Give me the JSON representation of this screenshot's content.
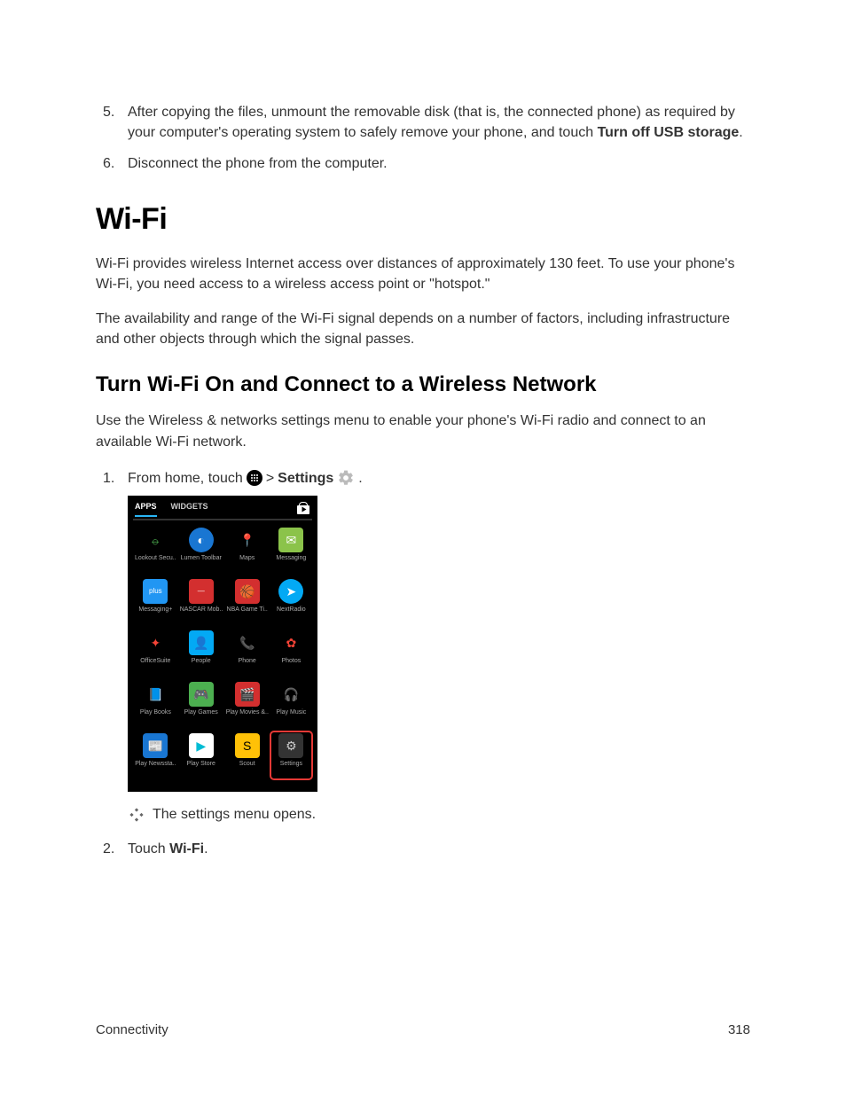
{
  "list_a": {
    "i5": {
      "num": "5.",
      "pre": "After copying the files, unmount the removable disk (that is, the connected phone) as required by your computer's operating system to safely remove your phone, and touch ",
      "bold": "Turn off USB storage",
      "post": "."
    },
    "i6": {
      "num": "6.",
      "text": "Disconnect the phone from the computer."
    }
  },
  "heading_wifi": "Wi-Fi",
  "para_wifi_1": "Wi-Fi provides wireless Internet access over distances of approximately 130 feet. To use your phone's Wi-Fi, you need access to a wireless access point or \"hotspot.\"",
  "para_wifi_2": "The availability and range of the Wi-Fi signal depends on a number of factors, including infrastructure and other objects through which the signal passes.",
  "heading_turn": "Turn Wi-Fi On and Connect to a Wireless Network",
  "para_turn": "Use the Wireless & networks settings menu to enable your phone's Wi-Fi radio and connect to an available Wi-Fi network.",
  "steps": {
    "s1": {
      "num": "1.",
      "pre": "From home, touch ",
      "gt": " > ",
      "settings_bold": "Settings",
      "period": " ."
    },
    "s2": {
      "num": "2.",
      "pre": "Touch ",
      "bold": "Wi-Fi",
      "post": "."
    }
  },
  "phone": {
    "tab_apps": "APPS",
    "tab_widgets": "WIDGETS",
    "apps": [
      {
        "label": "Lookout Secu..",
        "color": "#000",
        "char": "⦵",
        "fg": "#4caf50"
      },
      {
        "label": "Lumen Toolbar",
        "color": "#1976d2",
        "char": "◐",
        "fg": "#fff",
        "round": true
      },
      {
        "label": "Maps",
        "color": "#000",
        "char": "📍",
        "fg": "#fff"
      },
      {
        "label": "Messaging",
        "color": "#8bc34a",
        "char": "✉",
        "fg": "#fff"
      },
      {
        "label": "Messaging+",
        "color": "#2196f3",
        "char": "plus",
        "fg": "#fff",
        "small": true
      },
      {
        "label": "NASCAR Mob..",
        "color": "#d32f2f",
        "char": "—",
        "fg": "#fff",
        "small": true
      },
      {
        "label": "NBA Game Ti..",
        "color": "#d32f2f",
        "char": "🏀",
        "fg": "#fff"
      },
      {
        "label": "NextRadio",
        "color": "#03a9f4",
        "char": "➤",
        "fg": "#fff",
        "round": true
      },
      {
        "label": "OfficeSuite",
        "color": "#000",
        "char": "✦",
        "fg": "#f44336"
      },
      {
        "label": "People",
        "color": "#03a9f4",
        "char": "👤",
        "fg": "#fff"
      },
      {
        "label": "Phone",
        "color": "#000",
        "char": "📞",
        "fg": "#2196f3"
      },
      {
        "label": "Photos",
        "color": "#000",
        "char": "✿",
        "fg": "#f44336"
      },
      {
        "label": "Play Books",
        "color": "#000",
        "char": "📘",
        "fg": "#2196f3"
      },
      {
        "label": "Play Games",
        "color": "#4caf50",
        "char": "🎮",
        "fg": "#fff"
      },
      {
        "label": "Play Movies &..",
        "color": "#d32f2f",
        "char": "🎬",
        "fg": "#fff"
      },
      {
        "label": "Play Music",
        "color": "#000",
        "char": "🎧",
        "fg": "#ff9800"
      },
      {
        "label": "Play Newssta..",
        "color": "#1976d2",
        "char": "📰",
        "fg": "#fff"
      },
      {
        "label": "Play Store",
        "color": "#fff",
        "char": "▶",
        "fg": "#00bcd4"
      },
      {
        "label": "Scout",
        "color": "#ffc107",
        "char": "S",
        "fg": "#000"
      },
      {
        "label": "Settings",
        "color": "#333",
        "char": "⚙",
        "fg": "#ccc",
        "highlight": true
      }
    ]
  },
  "note_opens": "The settings menu opens.",
  "footer": {
    "left": "Connectivity",
    "right": "318"
  }
}
